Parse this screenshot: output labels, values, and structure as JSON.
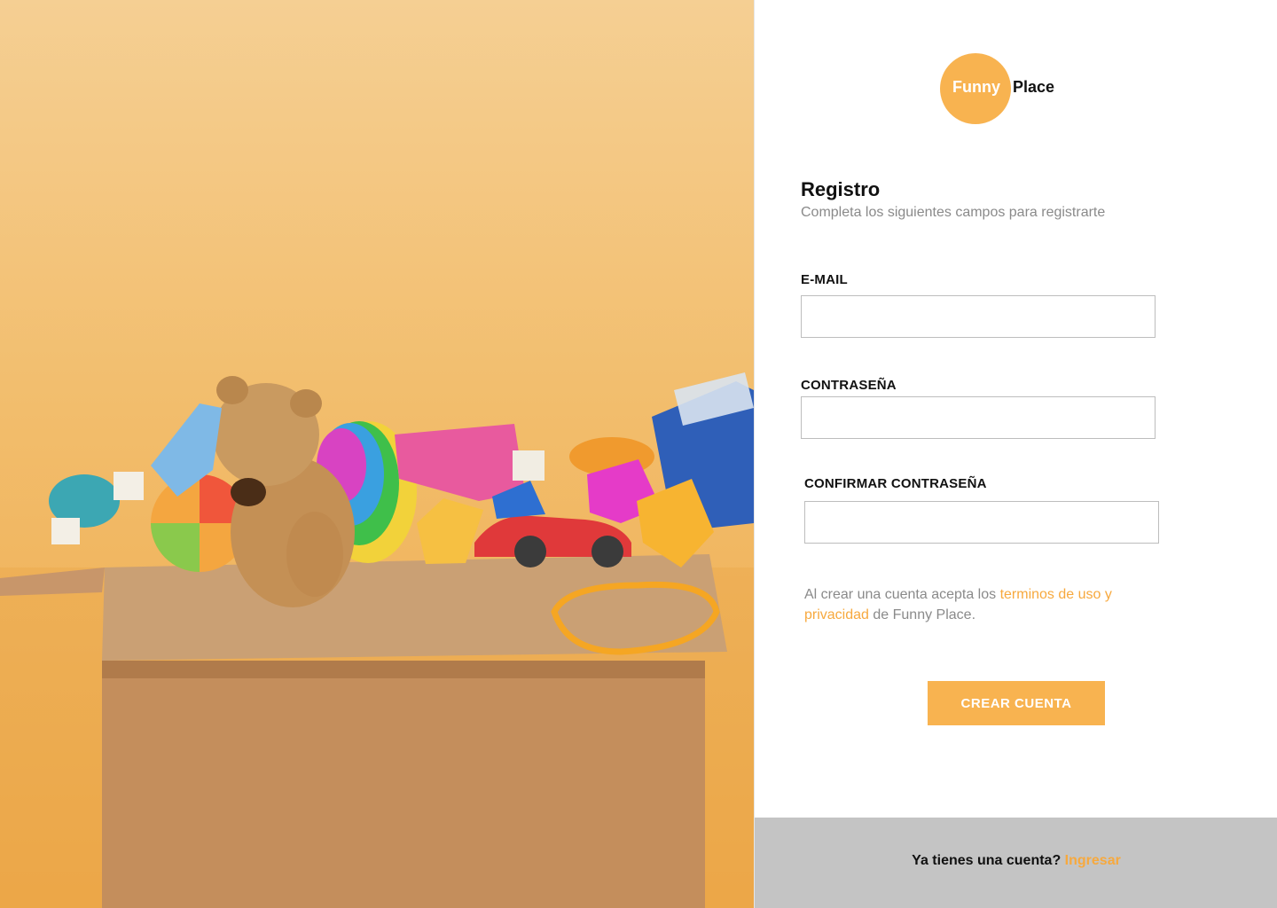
{
  "brand": {
    "first": "Funny",
    "second": "Place",
    "accent": "#f8b350"
  },
  "form": {
    "title": "Registro",
    "subtitle": "Completa los siguientes campos para registrarte",
    "email_label": "E-MAIL",
    "email_value": "",
    "password_label": "CONTRASEÑA",
    "password_value": "",
    "confirm_label": "CONFIRMAR CONTRASEÑA",
    "confirm_value": "",
    "terms_prefix": "Al crear una cuenta acepta los ",
    "terms_link": "terminos de uso y privacidad",
    "terms_suffix": " de Funny Place.",
    "submit_label": "CREAR CUENTA"
  },
  "footer": {
    "prompt": "Ya tienes una cuenta? ",
    "login_link": "Ingresar",
    "background": "#c4c4c4"
  },
  "hero": {
    "description_icon": "toy-box-image"
  }
}
